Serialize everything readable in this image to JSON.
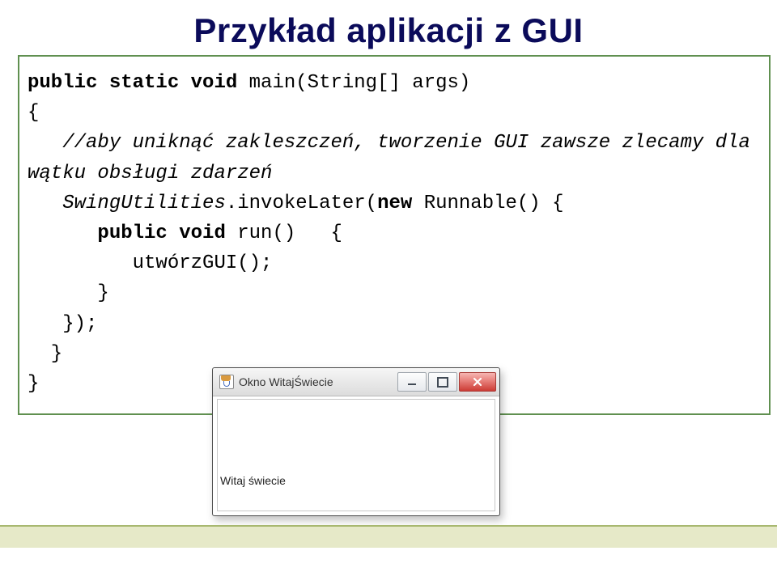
{
  "title": "Przykład aplikacji z GUI",
  "code": {
    "l1a": "public static void ",
    "l1b": "main(String[] args)",
    "l2": "{",
    "l3": "   //aby uniknąć zakleszczeń, tworzenie GUI zawsze zlecamy dla",
    "l4": "wątku obsługi zdarzeń",
    "l5a": "   SwingUtilities",
    "l5b": ".invokeLater(",
    "l5c": "new ",
    "l5d": "Runnable() {",
    "l6a": "      public void ",
    "l6b": "run()   {",
    "l7": "         utwórzGUI();",
    "l8": "      }",
    "l9": "   });",
    "l10": "  }",
    "l11": "}"
  },
  "window": {
    "title": "Okno WitajŚwiecie",
    "label": "Witaj świecie"
  }
}
